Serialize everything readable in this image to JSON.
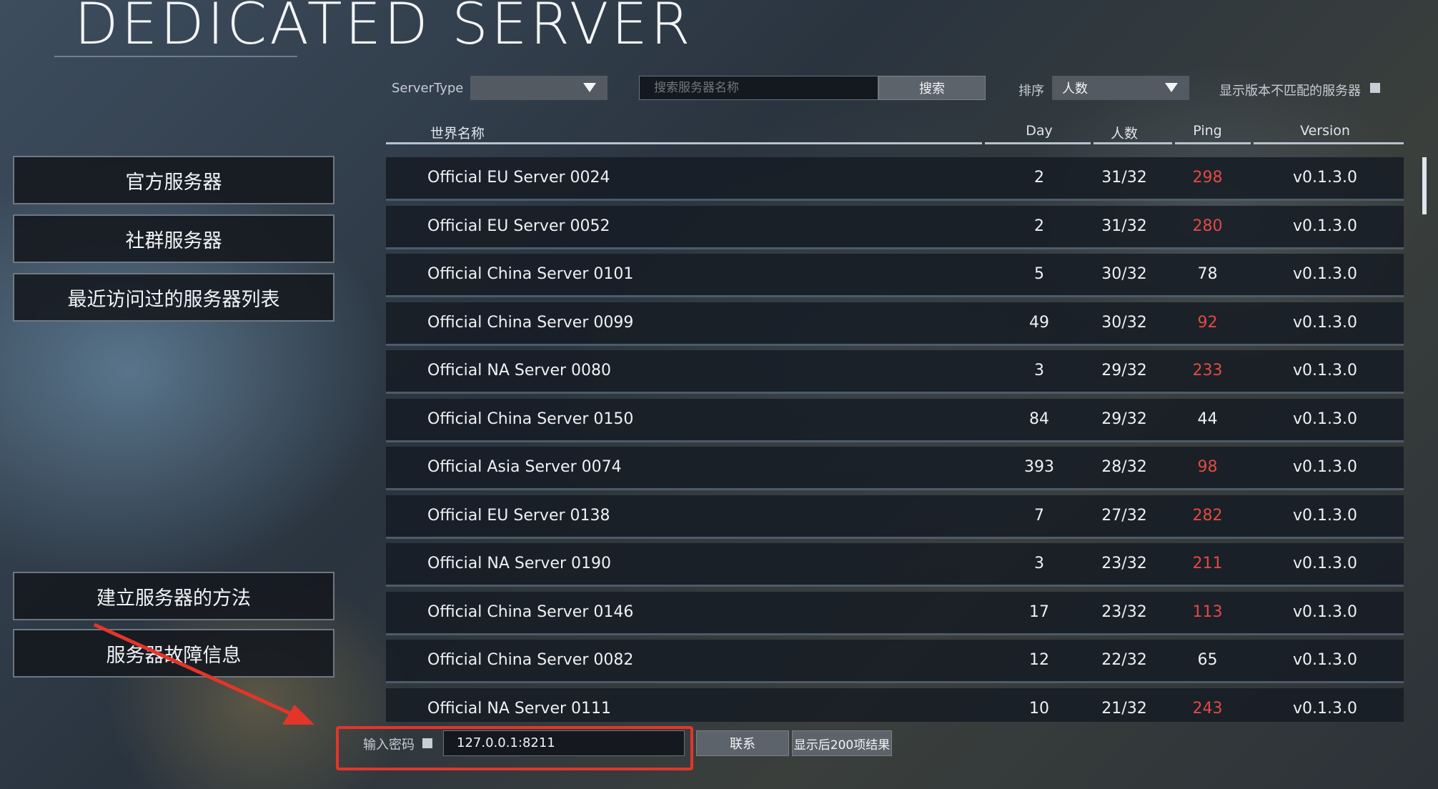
{
  "title": "DEDICATED SERVER",
  "nav": {
    "official": "官方服务器",
    "community": "社群服务器",
    "recent": "最近访问过的服务器列表",
    "howto": "建立服务器的方法",
    "trouble": "服务器故障信息"
  },
  "filters": {
    "server_type_label": "ServerType",
    "server_type_value": "",
    "search_placeholder": "搜索服务器名称",
    "search_button": "搜索",
    "sort_label": "排序",
    "sort_value": "人数",
    "mismatch_label": "显示版本不匹配的服务器"
  },
  "table": {
    "headers": {
      "name": "世界名称",
      "day": "Day",
      "players": "人数",
      "ping": "Ping",
      "version": "Version"
    },
    "rows": [
      {
        "name": "Official EU Server 0024",
        "day": "2",
        "players": "31/32",
        "ping": "298",
        "ping_high": true,
        "version": "v0.1.3.0"
      },
      {
        "name": "Official EU Server 0052",
        "day": "2",
        "players": "31/32",
        "ping": "280",
        "ping_high": true,
        "version": "v0.1.3.0"
      },
      {
        "name": "Official China Server 0101",
        "day": "5",
        "players": "30/32",
        "ping": "78",
        "ping_high": false,
        "version": "v0.1.3.0"
      },
      {
        "name": "Official China Server 0099",
        "day": "49",
        "players": "30/32",
        "ping": "92",
        "ping_high": true,
        "version": "v0.1.3.0"
      },
      {
        "name": "Official NA Server 0080",
        "day": "3",
        "players": "29/32",
        "ping": "233",
        "ping_high": true,
        "version": "v0.1.3.0"
      },
      {
        "name": "Official China Server 0150",
        "day": "84",
        "players": "29/32",
        "ping": "44",
        "ping_high": false,
        "version": "v0.1.3.0"
      },
      {
        "name": "Official Asia Server 0074",
        "day": "393",
        "players": "28/32",
        "ping": "98",
        "ping_high": true,
        "version": "v0.1.3.0"
      },
      {
        "name": "Official EU Server 0138",
        "day": "7",
        "players": "27/32",
        "ping": "282",
        "ping_high": true,
        "version": "v0.1.3.0"
      },
      {
        "name": "Official NA Server 0190",
        "day": "3",
        "players": "23/32",
        "ping": "211",
        "ping_high": true,
        "version": "v0.1.3.0"
      },
      {
        "name": "Official China Server 0146",
        "day": "17",
        "players": "23/32",
        "ping": "113",
        "ping_high": true,
        "version": "v0.1.3.0"
      },
      {
        "name": "Official China Server 0082",
        "day": "12",
        "players": "22/32",
        "ping": "65",
        "ping_high": false,
        "version": "v0.1.3.0"
      },
      {
        "name": "Official NA Server 0111",
        "day": "10",
        "players": "21/32",
        "ping": "243",
        "ping_high": true,
        "version": "v0.1.3.0"
      }
    ]
  },
  "bottom": {
    "password_label": "输入密码",
    "address_value": "127.0.0.1:8211",
    "connect_button": "联系",
    "show_more_button": "显示后200项结果"
  },
  "colors": {
    "ping_high": "#e04a44",
    "ping_ok": "#eef1f5",
    "annotation": "#e4352a"
  }
}
